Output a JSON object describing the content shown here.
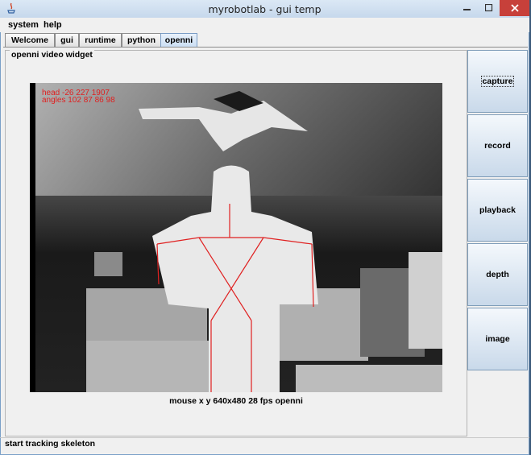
{
  "window": {
    "title": "myrobotlab - gui temp"
  },
  "menu": [
    {
      "label": "system"
    },
    {
      "label": "help"
    }
  ],
  "tabs": [
    {
      "label": "Welcome",
      "active": false
    },
    {
      "label": "gui",
      "active": false
    },
    {
      "label": "runtime",
      "active": false
    },
    {
      "label": "python",
      "active": false
    },
    {
      "label": "openni",
      "active": true
    }
  ],
  "panel": {
    "title": "openni  video widget"
  },
  "video": {
    "overlay_line1": "head -26 227 1907",
    "overlay_line2": "angles 102 87 86 98",
    "status": "mouse x y  640x480  28 fps  openni",
    "skeleton_color": "#e02020"
  },
  "side_buttons": [
    {
      "label": "capture",
      "focused": true
    },
    {
      "label": "record",
      "focused": false
    },
    {
      "label": "playback",
      "focused": false
    },
    {
      "label": "depth",
      "focused": false
    },
    {
      "label": "image",
      "focused": false
    }
  ],
  "statusbar": {
    "text": "start tracking skeleton"
  },
  "colors": {
    "close_button": "#c7403a",
    "active_tab": "#cbdff4"
  }
}
